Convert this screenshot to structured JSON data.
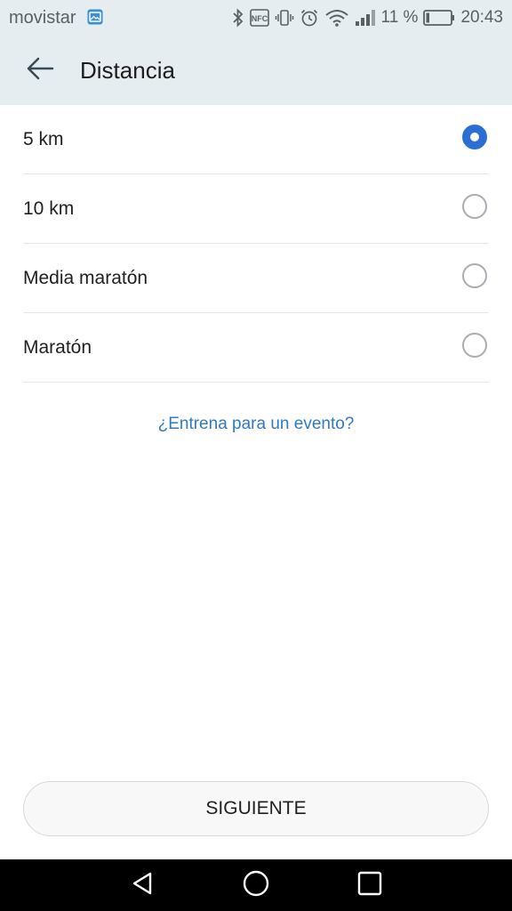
{
  "status_bar": {
    "carrier": "movistar",
    "battery_percent": "11 %",
    "time": "20:43",
    "icons": [
      "image-icon",
      "bluetooth-icon",
      "nfc-icon",
      "vibrate-icon",
      "alarm-icon",
      "wifi-icon",
      "signal-icon",
      "battery-icon"
    ],
    "nfc_text": "NFC"
  },
  "app_bar": {
    "title": "Distancia"
  },
  "options": [
    {
      "label": "5 km",
      "selected": true
    },
    {
      "label": "10 km",
      "selected": false
    },
    {
      "label": "Media maratón",
      "selected": false
    },
    {
      "label": "Maratón",
      "selected": false
    }
  ],
  "event_link": "¿Entrena para un evento?",
  "next_button": "SIGUIENTE",
  "nav_bar": {
    "icons": [
      "back-triangle-icon",
      "home-circle-icon",
      "recents-square-icon"
    ]
  },
  "colors": {
    "accent": "#2a6fd6",
    "link": "#2e7ac7",
    "header_bg": "#e6edf0"
  }
}
